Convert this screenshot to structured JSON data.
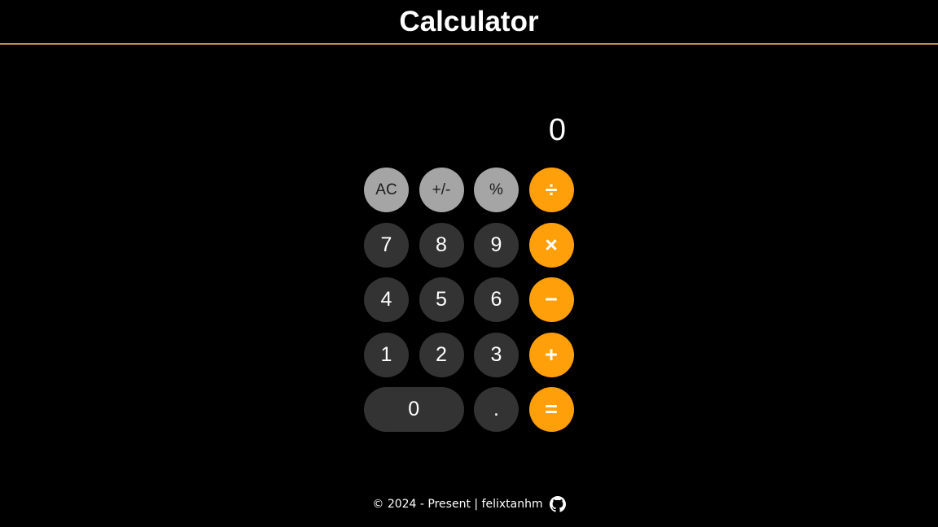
{
  "header": {
    "title": "Calculator"
  },
  "display": {
    "value": "0"
  },
  "keys": {
    "ac": "AC",
    "sign": "+/-",
    "percent": "%",
    "divide": "÷",
    "seven": "7",
    "eight": "8",
    "nine": "9",
    "multiply": "×",
    "four": "4",
    "five": "5",
    "six": "6",
    "subtract": "−",
    "one": "1",
    "two": "2",
    "three": "3",
    "add": "+",
    "zero": "0",
    "decimal": ".",
    "equals": "="
  },
  "footer": {
    "text": "© 2024 - Present | felixtanhm",
    "icon": "github-icon"
  },
  "colors": {
    "background": "#000000",
    "header_border": "#b8905a",
    "function_key": "#a5a5a5",
    "number_key": "#333333",
    "operator_key": "#ff9f0a"
  }
}
